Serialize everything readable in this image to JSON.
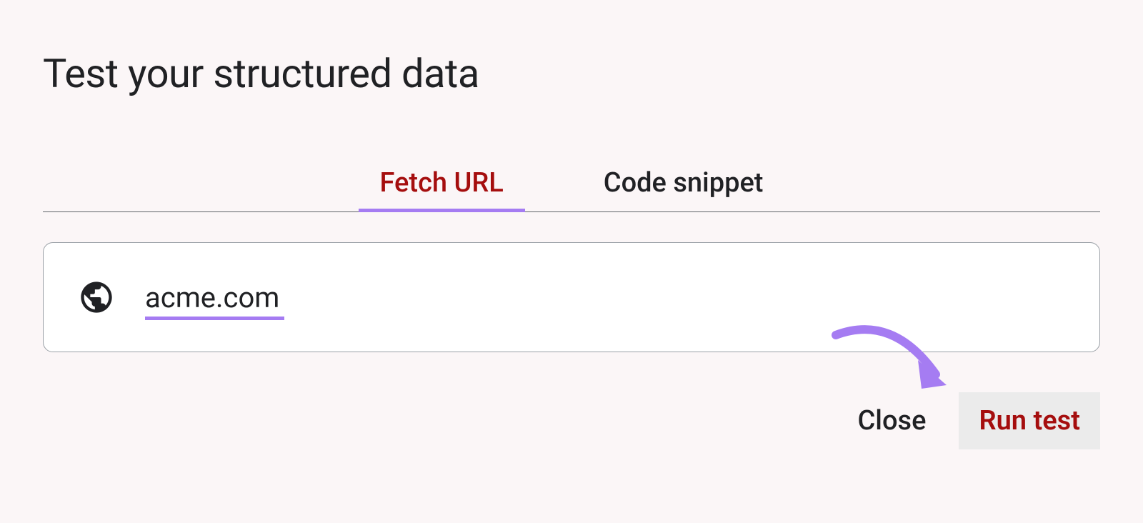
{
  "title": "Test your structured data",
  "tabs": {
    "fetch_url": "Fetch URL",
    "code_snippet": "Code snippet"
  },
  "input": {
    "value": "acme.com"
  },
  "actions": {
    "close": "Close",
    "run": "Run test"
  }
}
